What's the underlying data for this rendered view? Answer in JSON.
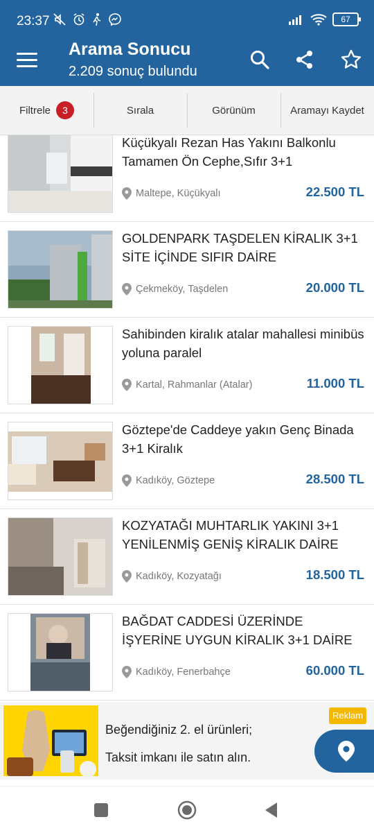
{
  "status": {
    "time": "23:37",
    "battery": "67"
  },
  "header": {
    "title": "Arama Sonucu",
    "subtitle": "2.209 sonuç bulundu"
  },
  "toolbar": {
    "filter_label": "Filtrele",
    "filter_count": "3",
    "sort_label": "Sırala",
    "view_label": "Görünüm",
    "save_search_label": "Aramayı Kaydet"
  },
  "listings": [
    {
      "title": "Küçükyalı Rezan Has Yakını Balkonlu Tamamen Ön Cephe,Sıfır 3+1",
      "location": "Maltepe, Küçükyalı",
      "price": "22.500 TL"
    },
    {
      "title": "GOLDENPARK TAŞDELEN KİRALIK 3+1 SİTE İÇİNDE SIFIR DAİRE",
      "location": "Çekmeköy, Taşdelen",
      "price": "20.000 TL"
    },
    {
      "title": "Sahibinden kiralık atalar mahallesi minibüs yoluna paralel",
      "location": "Kartal, Rahmanlar (Atalar)",
      "price": "11.000 TL"
    },
    {
      "title": "Göztepe'de Caddeye yakın Genç Binada 3+1 Kiralık",
      "location": "Kadıköy, Göztepe",
      "price": "28.500 TL"
    },
    {
      "title": "KOZYATAĞI MUHTARLIK YAKINI 3+1 YENİLENMİŞ GENİŞ KİRALIK DAİRE",
      "location": "Kadıköy, Kozyatağı",
      "price": "18.500 TL"
    },
    {
      "title": "BAĞDAT CADDESİ ÜZERİNDE İŞYERİNE UYGUN KİRALIK 3+1 DAİRE",
      "location": "Kadıköy, Fenerbahçe",
      "price": "60.000 TL"
    }
  ],
  "ad": {
    "line1": "Beğendiğiniz 2. el ürünleri;",
    "line2": "Taksit imkanı ile satın alın.",
    "badge": "Reklam"
  },
  "colors": {
    "brand": "#23649e",
    "badge_red": "#c81e26",
    "ad_yellow": "#f5b800"
  }
}
